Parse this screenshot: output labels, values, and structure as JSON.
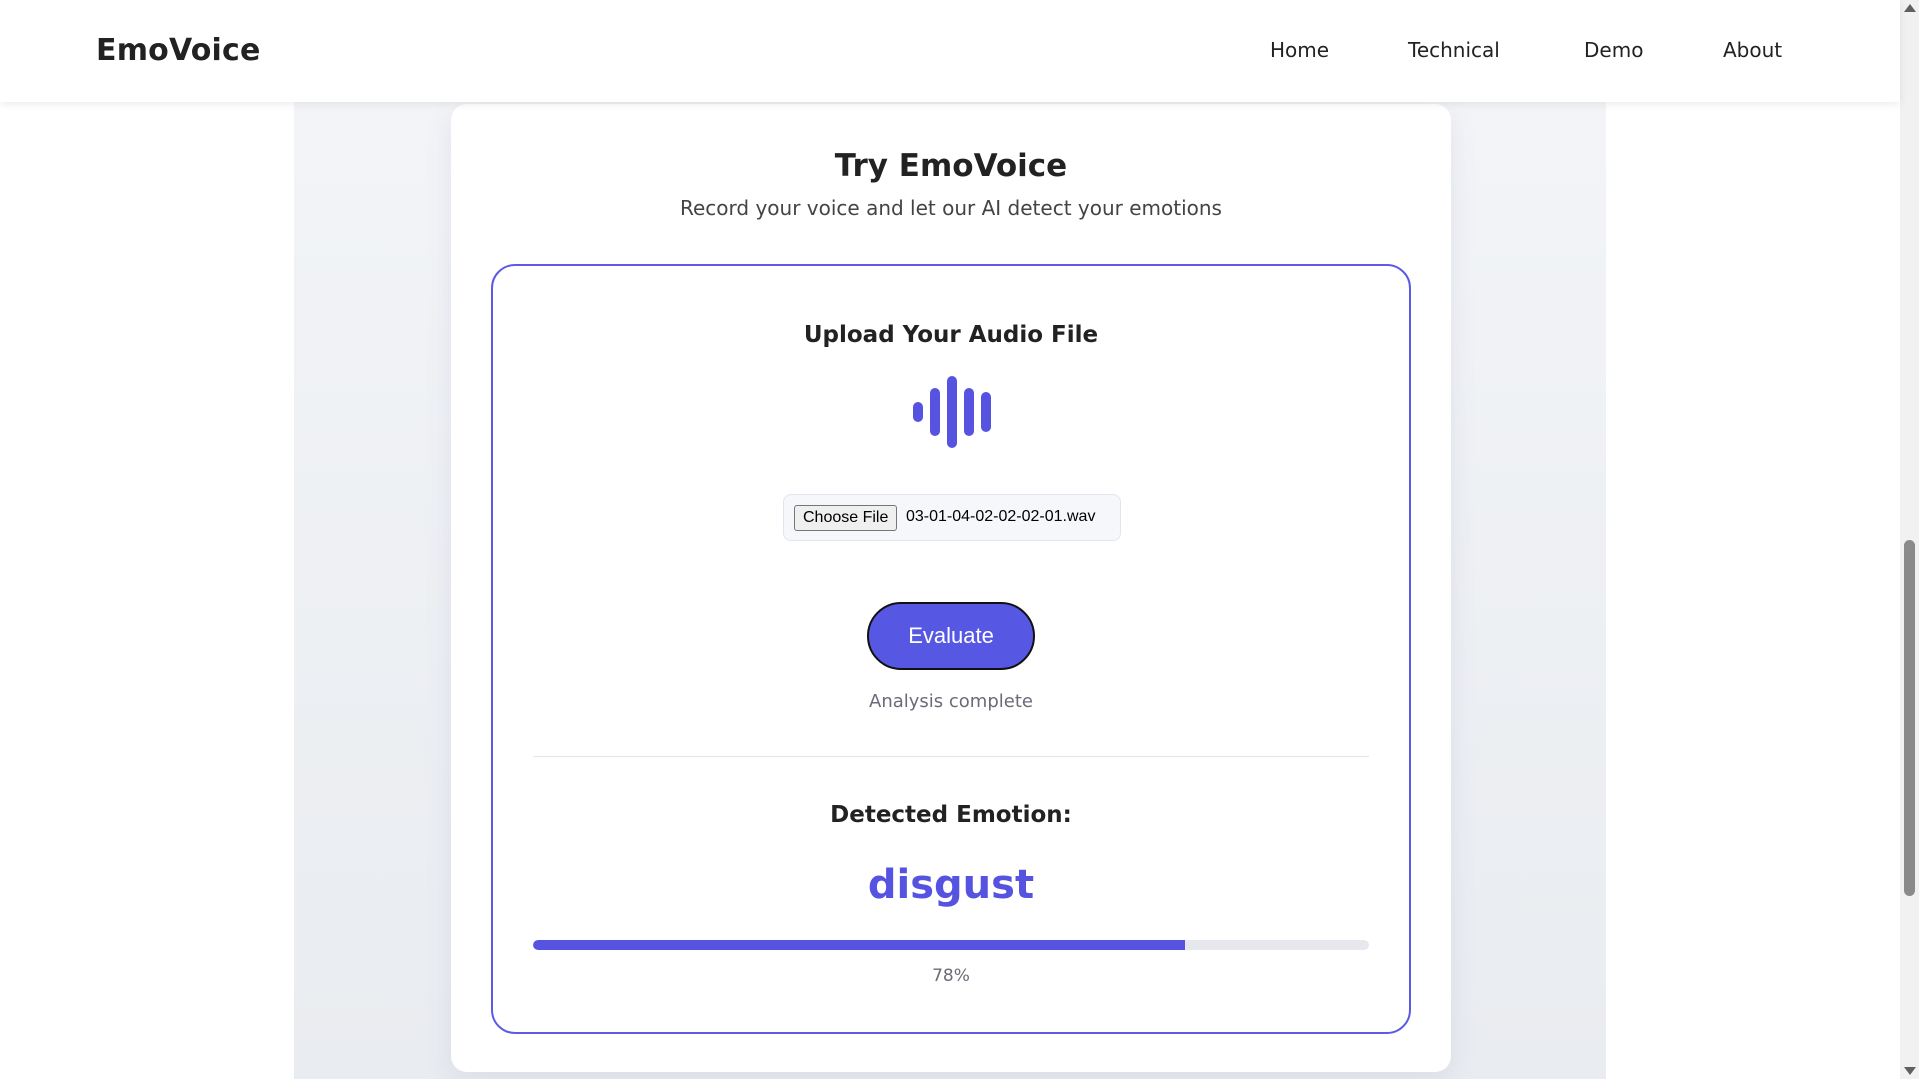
{
  "header": {
    "logo": "EmoVoice",
    "nav": [
      "Home",
      "Technical",
      "Demo",
      "About"
    ]
  },
  "card": {
    "title": "Try EmoVoice",
    "subtitle": "Record your voice and let our AI detect your emotions"
  },
  "upload": {
    "title": "Upload Your Audio File",
    "wave_icon": "audio-wave-icon",
    "choose_button": "Choose File",
    "file_name": "03-01-04-02-02-02-01.wav",
    "evaluate_button": "Evaluate",
    "status": "Analysis complete"
  },
  "result": {
    "title": "Detected Emotion:",
    "emotion": "disgust",
    "confidence_label": "78%",
    "confidence_percent": 78
  },
  "colors": {
    "accent": "#5553e0",
    "panel_border": "#5b5be6",
    "button": "#5658e4"
  }
}
